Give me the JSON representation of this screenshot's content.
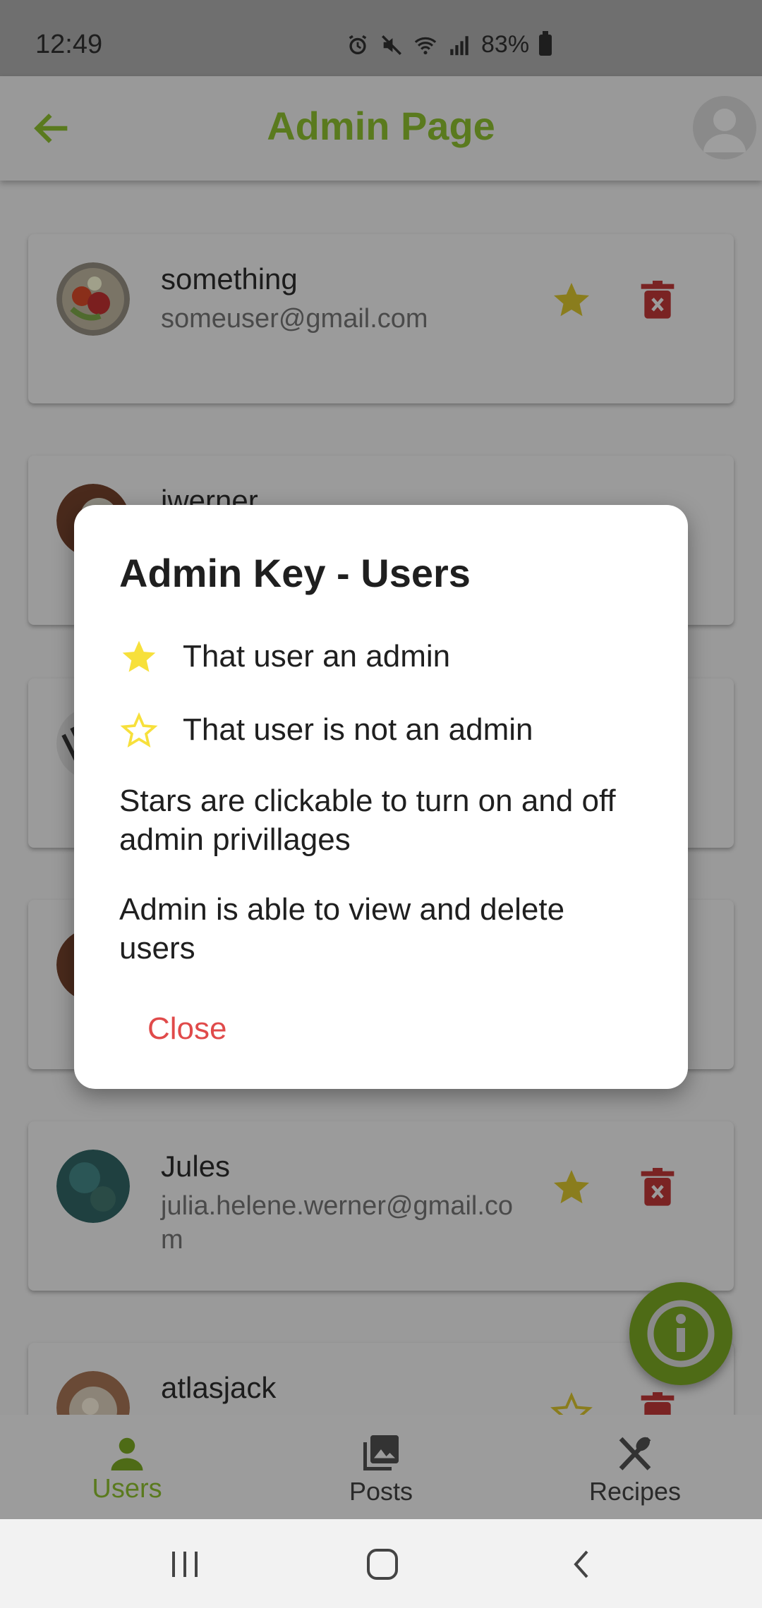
{
  "status_bar": {
    "time": "12:49",
    "battery": "83%"
  },
  "app_bar": {
    "title": "Admin Page"
  },
  "users": [
    {
      "name": "something",
      "email": "someuser@gmail.com",
      "admin": true
    },
    {
      "name": "jwerner",
      "email": "",
      "admin": false
    },
    {
      "name": "",
      "email": "",
      "admin": false
    },
    {
      "name": "",
      "email": "",
      "admin": false
    },
    {
      "name": "Jules",
      "email": "julia.helene.werner@gmail.com",
      "admin": true
    },
    {
      "name": "atlasjack",
      "email": "",
      "admin": false
    }
  ],
  "dialog": {
    "title": "Admin Key - Users",
    "admin_key": "That user an admin",
    "not_admin_key": "That user is not an admin",
    "para1": "Stars are clickable to turn on and off admin privillages",
    "para2": "Admin is able to view and delete users",
    "close_label": "Close"
  },
  "bottom_nav": [
    {
      "label": "Users",
      "icon": "person-icon",
      "active": true
    },
    {
      "label": "Posts",
      "icon": "photo-library-icon",
      "active": false
    },
    {
      "label": "Recipes",
      "icon": "fork-spoon-icon",
      "active": false
    }
  ],
  "colors": {
    "accent_green": "#7aa32b",
    "admin_star": "#f7e03b",
    "delete_red": "#d93a3a",
    "close_red": "#e04a4a"
  }
}
